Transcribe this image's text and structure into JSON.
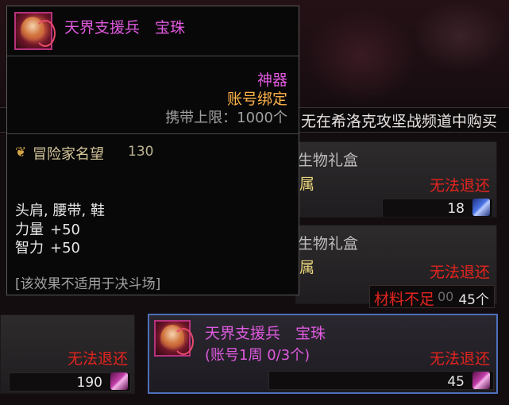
{
  "notice": {
    "text": "无在希洛克攻坚战频道中购买"
  },
  "cards": [
    {
      "name": "生物礼盒",
      "sub": "属",
      "status": "无法退还",
      "price": "18",
      "currency_icon": "blue-crystal-icon"
    },
    {
      "name": "生物礼盒",
      "sub": "属",
      "status": "无法退还",
      "price": "",
      "currency_icon": ""
    },
    {
      "name": "",
      "sub": "",
      "status": "无法退还",
      "price": "190",
      "currency_icon": "pink-crystal-icon"
    },
    {
      "name": "天界支援兵　宝珠",
      "sub": "(账号1周 0/3个)",
      "status": "无法退还",
      "price": "45",
      "currency_icon": "pink-crystal-icon"
    }
  ],
  "shortage": {
    "label": "材料不足",
    "ghost": "00",
    "amount": "45个"
  },
  "tooltip": {
    "title": "天界支援兵　宝珠",
    "rarity": "神器",
    "bind": "账号绑定",
    "carry_limit": "携带上限：1000个",
    "fame_label": "冒险家名望",
    "fame_value": "130",
    "slots": "头肩, 腰带, 鞋",
    "stats": [
      {
        "name": "力量",
        "value": "+50"
      },
      {
        "name": "智力",
        "value": "+50"
      }
    ],
    "note": "[该效果不适用于决斗场]"
  },
  "colors": {
    "epic": "#e05ae0",
    "bind": "#ffb24a",
    "no_refund": "#e3241f",
    "selected_border": "#4d6fb8"
  }
}
